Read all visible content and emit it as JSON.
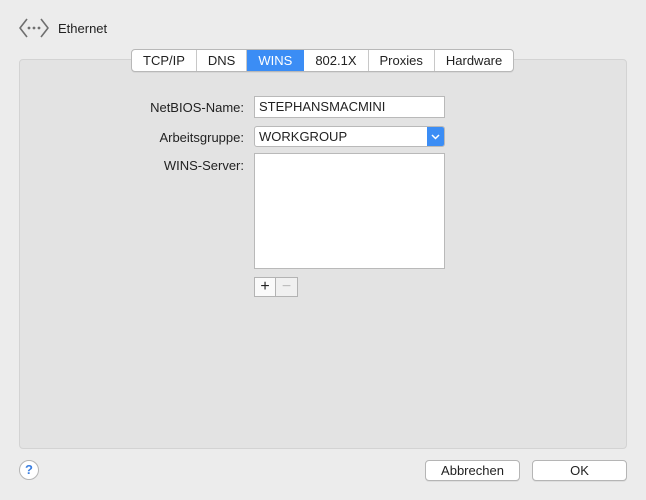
{
  "header": {
    "icon": "ethernet-icon",
    "title": "Ethernet"
  },
  "tabs": [
    {
      "label": "TCP/IP",
      "active": false
    },
    {
      "label": "DNS",
      "active": false
    },
    {
      "label": "WINS",
      "active": true
    },
    {
      "label": "802.1X",
      "active": false
    },
    {
      "label": "Proxies",
      "active": false
    },
    {
      "label": "Hardware",
      "active": false
    }
  ],
  "form": {
    "netbios_label": "NetBIOS-Name:",
    "netbios_value": "STEPHANSMACMINI",
    "workgroup_label": "Arbeitsgruppe:",
    "workgroup_value": "WORKGROUP",
    "wins_label": "WINS-Server:",
    "wins_servers": []
  },
  "list_controls": {
    "add_label": "+",
    "remove_label": "−"
  },
  "footer": {
    "help_label": "?",
    "cancel_label": "Abbrechen",
    "ok_label": "OK"
  },
  "colors": {
    "accent": "#3b8df5",
    "window_bg": "#ececec",
    "panel_bg": "#e3e3e3"
  }
}
